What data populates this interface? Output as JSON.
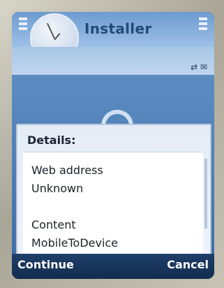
{
  "header": {
    "title": "Installer"
  },
  "dialog": {
    "title": "Details:",
    "web_address_label": "Web address",
    "web_address_value": "Unknown",
    "content_label": "Content",
    "content_value": "MobileToDevice"
  },
  "softkeys": {
    "left": "Continue",
    "right": "Cancel"
  },
  "icons": {
    "clock": "clock-icon",
    "signal": "signal-icon",
    "battery": "battery-icon",
    "status": "status-icons",
    "spinner": "loading-spinner-icon"
  },
  "colors": {
    "title_bg": "#9dc0e6",
    "dialog_bg": "#eef3fa",
    "softkey_bg": "#132c4e"
  }
}
